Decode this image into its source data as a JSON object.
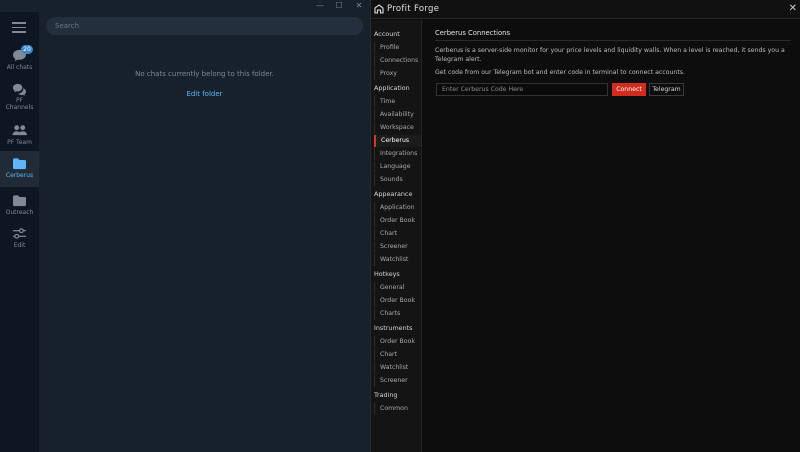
{
  "telegram": {
    "search_placeholder": "Search",
    "folders": [
      {
        "label": "All chats",
        "badge": "20",
        "icon": "chat-bubble-icon"
      },
      {
        "label": "PF Channels",
        "icon": "chat-bubbles-icon"
      },
      {
        "label": "PF Team",
        "icon": "people-icon"
      },
      {
        "label": "Cerberus",
        "icon": "folder-icon"
      },
      {
        "label": "Outreach",
        "icon": "folder-icon"
      },
      {
        "label": "Edit",
        "icon": "sliders-icon"
      }
    ],
    "empty_message": "No chats currently belong to this folder.",
    "edit_folder_link": "Edit folder",
    "window_controls": {
      "minimize": "—",
      "maximize": "☐",
      "close": "✕"
    },
    "active_color": "#5eb5f7",
    "badge_color": "#3e88c9"
  },
  "profit_forge": {
    "title": "Profit Forge",
    "close_glyph": "✕",
    "nav": [
      {
        "category": "Account",
        "items": [
          "Profile",
          "Connections",
          "Proxy"
        ]
      },
      {
        "category": "Application",
        "items": [
          "Time",
          "Availability",
          "Workspace",
          "Cerberus",
          "Integrations",
          "Language",
          "Sounds"
        ]
      },
      {
        "category": "Appearance",
        "items": [
          "Application",
          "Order Book",
          "Chart",
          "Screener",
          "Watchlist"
        ]
      },
      {
        "category": "Hotkeys",
        "items": [
          "General",
          "Order Book",
          "Charts"
        ]
      },
      {
        "category": "Instruments",
        "items": [
          "Order Book",
          "Chart",
          "Watchlist",
          "Screener"
        ]
      },
      {
        "category": "Trading",
        "items": [
          "Common"
        ]
      }
    ],
    "active_item": "Cerberus",
    "section_title": "Cerberus Connections",
    "description_1": "Cerberus is a server-side monitor for your price levels and liquidity walls. When a level is reached, it sends you a Telegram alert.",
    "description_2": "Get code from our Telegram bot and enter code in terminal to connect accounts.",
    "code_placeholder": "Enter Cerberus Code Here",
    "connect_label": "Connect",
    "telegram_label": "Telegram",
    "accent_color": "#d22b1f"
  }
}
